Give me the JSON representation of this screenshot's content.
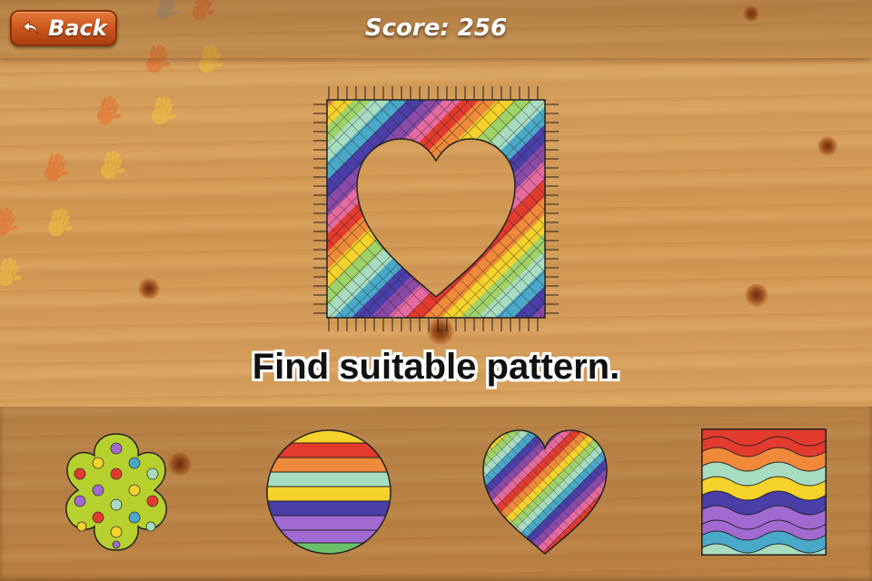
{
  "header": {
    "back_label": "Back",
    "score_text": "Score: 256"
  },
  "instruction": "Find suitable pattern.",
  "target": {
    "shape": "heart-cutout",
    "pattern": "diagonal-rainbow-grid"
  },
  "options": [
    {
      "shape": "flower",
      "pattern": "polka-dots"
    },
    {
      "shape": "circle",
      "pattern": "horizontal-stripes"
    },
    {
      "shape": "heart",
      "pattern": "diagonal-rainbow-grid"
    },
    {
      "shape": "square",
      "pattern": "waves"
    }
  ],
  "colors": {
    "back_button": "#c9531b",
    "rainbow": [
      "#e23b2e",
      "#f08a3a",
      "#f6d22c",
      "#9fd36a",
      "#a8dcc0",
      "#4aa8c8",
      "#4a3ea8",
      "#8a4aa8",
      "#e56aa0"
    ]
  }
}
